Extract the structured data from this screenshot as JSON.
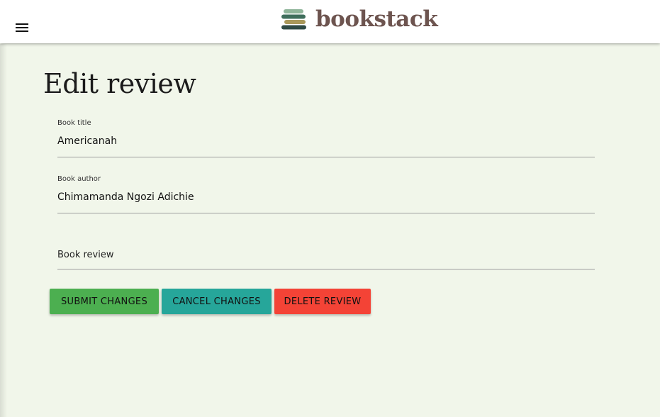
{
  "brand": {
    "name": "bookstack",
    "text_color": "#6d544f"
  },
  "navbar": {
    "menu_icon": "hamburger-menu-icon",
    "logo_icon": "book-stack-icon"
  },
  "page": {
    "title": "Edit review"
  },
  "form": {
    "book_title": {
      "label": "Book title",
      "value": "Americanah"
    },
    "book_author": {
      "label": "Book author",
      "value": "Chimamanda Ngozi Adichie"
    },
    "book_review": {
      "placeholder": "Book review",
      "value": ""
    }
  },
  "buttons": {
    "submit": {
      "label": "SUBMIT CHANGES",
      "color": "#4caf50"
    },
    "cancel": {
      "label": "CANCEL CHANGES",
      "color": "#26a69a"
    },
    "delete": {
      "label": "DELETE REVIEW",
      "color": "#f44336"
    }
  },
  "colors": {
    "background": "#f1f6ea",
    "navbar": "#ffffff"
  }
}
